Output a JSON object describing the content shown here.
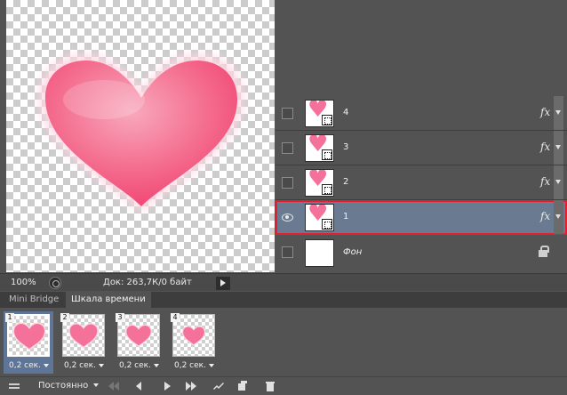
{
  "canvas": {
    "heart_color": "#f4729a",
    "glow_color": "#ffd7e3"
  },
  "layers_panel": {
    "layers": [
      {
        "name": "4",
        "visible": false,
        "selected": false,
        "fx": "fx"
      },
      {
        "name": "3",
        "visible": false,
        "selected": false,
        "fx": "fx"
      },
      {
        "name": "2",
        "visible": false,
        "selected": false,
        "fx": "fx"
      },
      {
        "name": "1",
        "visible": true,
        "selected": true,
        "fx": "fx"
      },
      {
        "name": "Фон",
        "visible": false,
        "selected": false,
        "locked": true
      }
    ],
    "selected_outline_color": "#e3202f",
    "selected_bg": "#6a7a90"
  },
  "status_bar": {
    "zoom": "100%",
    "doc_info": "Док: 263,7К/0 байт"
  },
  "tabs": [
    {
      "label": "Mini Bridge",
      "active": false
    },
    {
      "label": "Шкала времени",
      "active": true
    }
  ],
  "timeline": {
    "frames": [
      {
        "number": "1",
        "delay": "0,2 сек.",
        "selected": true,
        "heart_scale": 1.0
      },
      {
        "number": "2",
        "delay": "0,2 сек.",
        "selected": false,
        "heart_scale": 0.9
      },
      {
        "number": "3",
        "delay": "0,2 сек.",
        "selected": false,
        "heart_scale": 0.8
      },
      {
        "number": "4",
        "delay": "0,2 сек.",
        "selected": false,
        "heart_scale": 0.7
      }
    ]
  },
  "controls": {
    "loop": "Постоянно",
    "icons": [
      "convert-timeline-icon",
      "first-frame-icon",
      "prev-frame-icon",
      "play-icon",
      "next-frame-icon",
      "tween-icon",
      "duplicate-frame-icon",
      "trash-icon"
    ]
  }
}
